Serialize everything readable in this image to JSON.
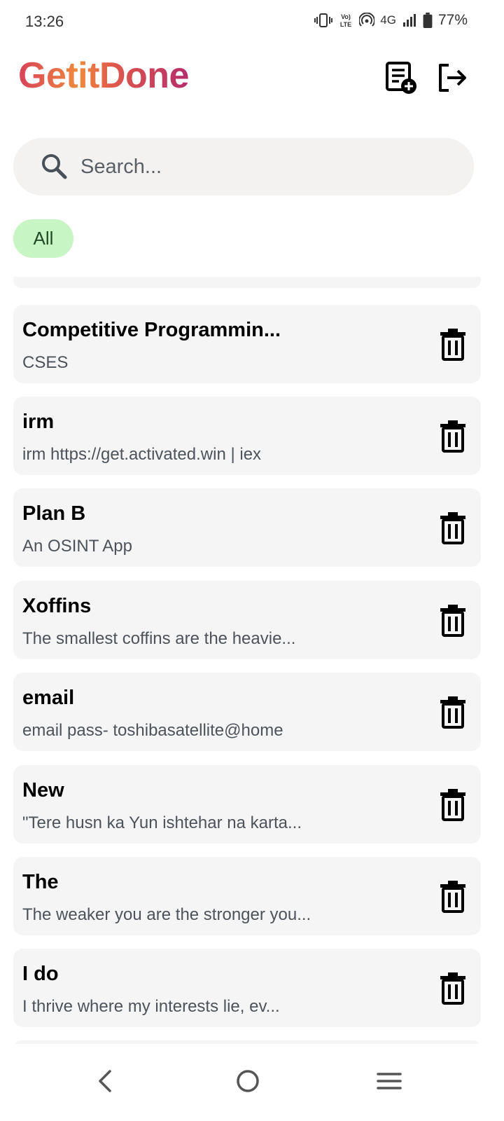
{
  "status_bar": {
    "time": "13:26",
    "network": "4G",
    "battery": "77%"
  },
  "header": {
    "title": "GetitDone",
    "new_note_icon": "note-add-icon",
    "logout_icon": "logout-icon"
  },
  "search": {
    "placeholder": "Search...",
    "value": ""
  },
  "filters": {
    "chips": [
      "All"
    ]
  },
  "notes": [
    {
      "title": "Competitive Programmin...",
      "subtitle": "CSES"
    },
    {
      "title": "irm",
      "subtitle": "irm https://get.activated.win | iex"
    },
    {
      "title": "Plan B",
      "subtitle": "An OSINT App"
    },
    {
      "title": "Xoffins",
      "subtitle": "The smallest coffins are the heavie..."
    },
    {
      "title": "email",
      "subtitle": "email pass- toshibasatellite@home"
    },
    {
      "title": "New",
      "subtitle": "\"Tere husn ka Yun ishtehar na karta..."
    },
    {
      "title": "The",
      "subtitle": "The weaker you are the stronger you..."
    },
    {
      "title": "I do",
      "subtitle": "I thrive where my interests lie, ev..."
    }
  ],
  "colors": {
    "title_gradient": [
      "#d8425a",
      "#ef8a3c",
      "#b52d6a"
    ],
    "chip_bg": "#c8f5c4",
    "card_bg": "#f5f5f5",
    "search_bg": "#f3f2f1"
  },
  "nav": {
    "back_icon": "back-icon",
    "home_icon": "home-icon",
    "menu_icon": "recents-menu-icon"
  }
}
